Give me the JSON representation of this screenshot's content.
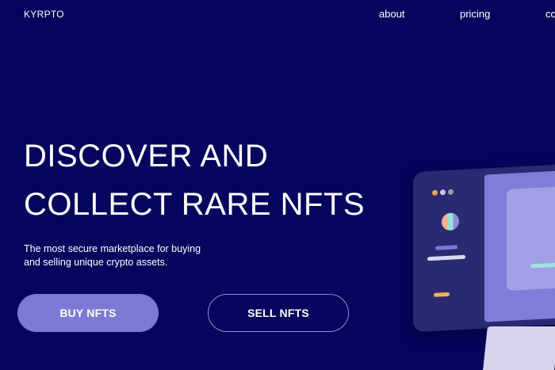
{
  "brand": {
    "logo": "KYRPTO"
  },
  "nav": {
    "about": "about",
    "pricing": "pricing",
    "contact": "contact"
  },
  "hero": {
    "line1": "DISCOVER AND",
    "line2": "COLLECT RARE NFTS",
    "subtitle": "The most secure marketplace for buying and selling unique crypto assets."
  },
  "buttons": {
    "buy": "BUY NFTS",
    "sell": "SELL NFTS"
  },
  "colors": {
    "background": "#05055e",
    "primary_button": "#7c7ad6",
    "text": "#ffffff"
  }
}
